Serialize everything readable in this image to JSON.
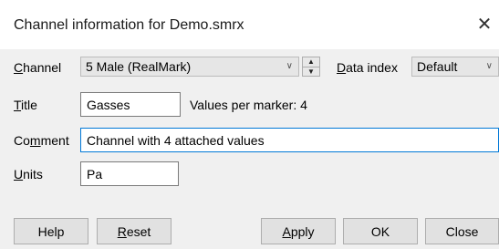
{
  "window": {
    "title": "Channel information for Demo.smrx",
    "close_glyph": "✕"
  },
  "channel": {
    "label": "Channel",
    "value": "5 Male (RealMark)"
  },
  "data_index": {
    "label": "Data index",
    "value": "Default"
  },
  "title_field": {
    "label": "Title",
    "value": "Gasses",
    "values_per_marker": "Values per marker: 4"
  },
  "comment_field": {
    "label": "Comment",
    "value": "Channel with 4 attached values"
  },
  "units_field": {
    "label": "Units",
    "value": "Pa"
  },
  "buttons": {
    "help": "Help",
    "reset": "Reset",
    "apply": "Apply",
    "ok": "OK",
    "close": "Close"
  },
  "icons": {
    "close": "close-icon",
    "dropdown": "chevron-down-icon",
    "spin_up": "triangle-up-icon",
    "spin_down": "triangle-down-icon"
  }
}
